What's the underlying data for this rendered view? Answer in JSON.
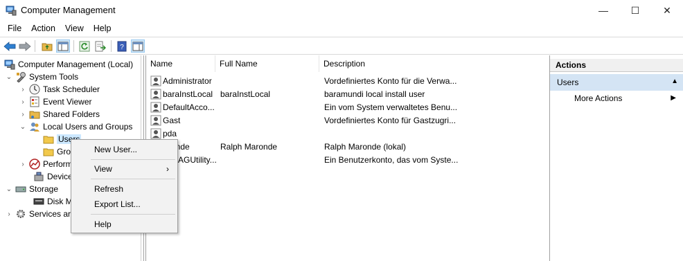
{
  "window": {
    "title": "Computer Management",
    "minimize_glyph": "—",
    "maximize_glyph": "☐",
    "close_glyph": "✕"
  },
  "menubar": [
    "File",
    "Action",
    "View",
    "Help"
  ],
  "tree": {
    "root": "Computer Management (Local)",
    "system_tools": "System Tools",
    "task_scheduler": "Task Scheduler",
    "event_viewer": "Event Viewer",
    "shared_folders": "Shared Folders",
    "local_users_groups": "Local Users and Groups",
    "users": "Users",
    "groups": "Gro",
    "performance": "Perform",
    "device_manager": "Device",
    "storage": "Storage",
    "disk_management": "Disk M",
    "services": "Services ar"
  },
  "list": {
    "columns": [
      "Name",
      "Full Name",
      "Description"
    ],
    "rows": [
      {
        "name": "Administrator",
        "full_name": "",
        "description": "Vordefiniertes Konto für die Verwa..."
      },
      {
        "name": "baraInstLocal",
        "full_name": "baraInstLocal",
        "description": "baramundi local install user"
      },
      {
        "name": "DefaultAcco...",
        "full_name": "",
        "description": "Ein vom System verwaltetes Benu..."
      },
      {
        "name": "Gast",
        "full_name": "",
        "description": "Vordefiniertes Konto für Gastzugri..."
      },
      {
        "name": "pda",
        "full_name": "",
        "description": ""
      },
      {
        "name": "ronde",
        "full_name": "Ralph Maronde",
        "description": "Ralph Maronde (lokal)"
      },
      {
        "name": "AGUtility...",
        "full_name": "",
        "description": "Ein Benutzerkonto, das vom Syste..."
      }
    ]
  },
  "actions": {
    "header": "Actions",
    "section": "Users",
    "more_actions": "More Actions"
  },
  "context_menu": {
    "new_user": "New User...",
    "view": "View",
    "refresh": "Refresh",
    "export_list": "Export List...",
    "help": "Help"
  },
  "colors": {
    "selection": "#cce8ff",
    "actions_section": "#d4e4f4",
    "folder": "#f2c94c"
  }
}
